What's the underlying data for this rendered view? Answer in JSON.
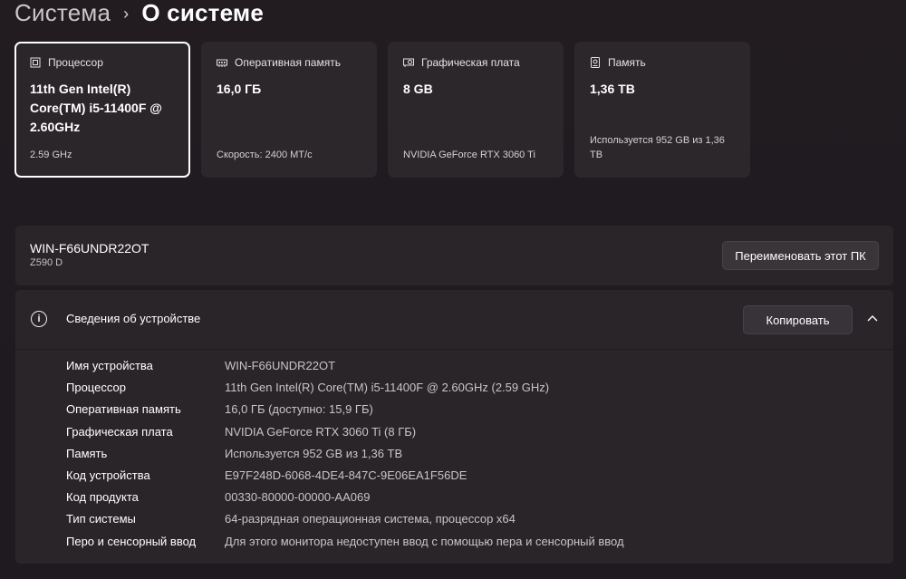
{
  "breadcrumb": {
    "parent": "Система",
    "separator": "›",
    "current": "О системе"
  },
  "cards": [
    {
      "icon": "processor-icon",
      "title": "Процессор",
      "value": "11th Gen Intel(R) Core(TM) i5-11400F @ 2.60GHz",
      "sub": "2.59 GHz",
      "selected": true
    },
    {
      "icon": "memory-icon",
      "title": "Оперативная память",
      "value": "16,0 ГБ",
      "sub": "Скорость: 2400 MT/c",
      "selected": false
    },
    {
      "icon": "graphics-card-icon",
      "title": "Графическая плата",
      "value": "8 GB",
      "sub": "NVIDIA GeForce RTX 3060 Ti",
      "selected": false
    },
    {
      "icon": "storage-icon",
      "title": "Память",
      "value": "1,36 TB",
      "sub": "Используется 952 GB из 1,36 TB",
      "selected": false
    }
  ],
  "pc": {
    "name": "WIN-F66UNDR22OT",
    "model": "Z590 D",
    "rename_label": "Переименовать этот ПК"
  },
  "device_info": {
    "title": "Сведения об устройстве",
    "copy_label": "Копировать",
    "rows": [
      {
        "label": "Имя устройства",
        "value": "WIN-F66UNDR22OT"
      },
      {
        "label": "Процессор",
        "value": "11th Gen Intel(R) Core(TM) i5-11400F @ 2.60GHz (2.59 GHz)"
      },
      {
        "label": "Оперативная память",
        "value": "16,0 ГБ (доступно: 15,9 ГБ)"
      },
      {
        "label": "Графическая плата",
        "value": "NVIDIA GeForce RTX 3060 Ti (8 ГБ)"
      },
      {
        "label": "Память",
        "value": "Используется 952 GB из 1,36 TB"
      },
      {
        "label": "Код устройства",
        "value": "E97F248D-6068-4DE4-847C-9E06EA1F56DE"
      },
      {
        "label": "Код продукта",
        "value": "00330-80000-00000-AA069"
      },
      {
        "label": "Тип системы",
        "value": "64-разрядная операционная система, процессор x64"
      },
      {
        "label": "Перо и сенсорный ввод",
        "value": "Для этого монитора недоступен ввод с помощью пера и сенсорный ввод"
      }
    ]
  }
}
